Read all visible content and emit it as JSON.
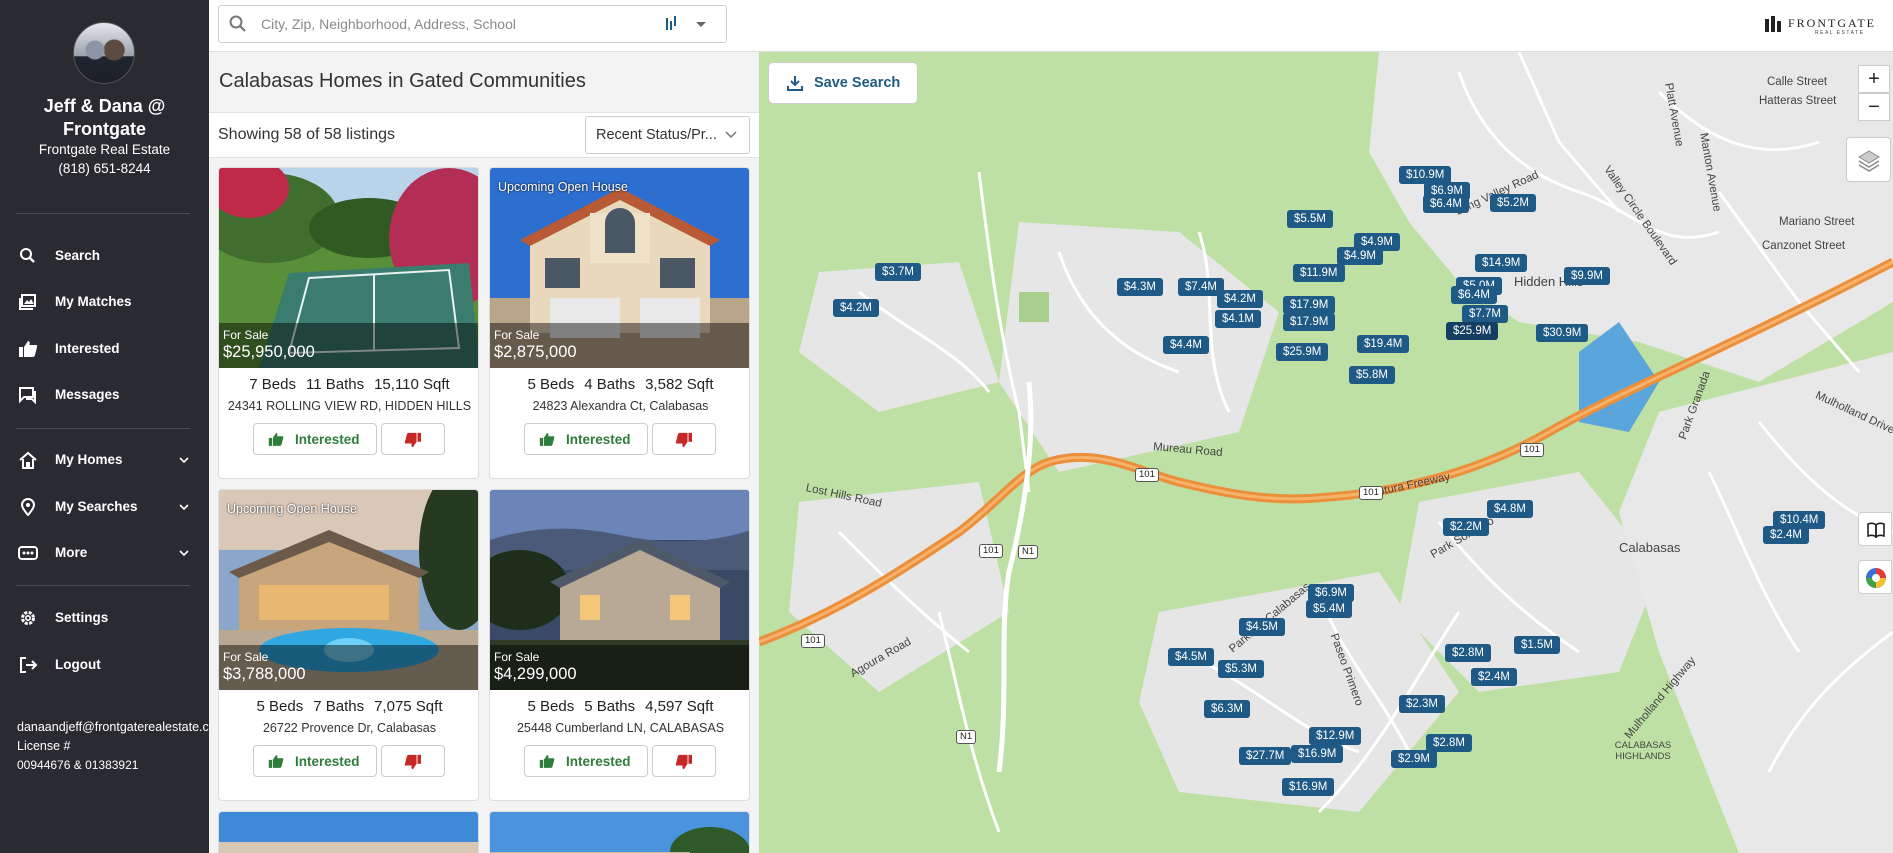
{
  "sidebar": {
    "agent_name": "Jeff & Dana @ Frontgate",
    "company": "Frontgate Real Estate",
    "phone": "(818) 651-8244",
    "nav": [
      {
        "label": "Search",
        "icon": "search-icon"
      },
      {
        "label": "My Matches",
        "icon": "gallery-icon"
      },
      {
        "label": "Interested",
        "icon": "thumbs-up-icon"
      },
      {
        "label": "Messages",
        "icon": "chat-icon"
      }
    ],
    "nav2": [
      {
        "label": "My Homes",
        "icon": "home-icon"
      },
      {
        "label": "My Searches",
        "icon": "location-pin-icon"
      },
      {
        "label": "More",
        "icon": "dots-icon"
      }
    ],
    "nav3": [
      {
        "label": "Settings",
        "icon": "gear-icon"
      },
      {
        "label": "Logout",
        "icon": "logout-icon"
      }
    ],
    "email": "danaandjeff@frontgaterealestate.com",
    "license_label": "License #",
    "license_numbers": "00944676 & 01383921"
  },
  "search": {
    "placeholder": "City, Zip, Neighborhood, Address, School"
  },
  "logo": {
    "name": "FRONTGATE",
    "sub": "REAL ESTATE"
  },
  "list": {
    "title": "Calabasas Homes in Gated Communities",
    "showing": "Showing 58 of 58 listings",
    "sort": "Recent Status/Pr...",
    "interested_label": "Interested",
    "listings": [
      {
        "status": "For Sale",
        "price": "$25,950,000",
        "beds": "7 Beds",
        "baths": "11 Baths",
        "sqft": "15,110 Sqft",
        "address": "24341 ROLLING VIEW RD, HIDDEN HILLS",
        "tag": ""
      },
      {
        "status": "For Sale",
        "price": "$2,875,000",
        "beds": "5 Beds",
        "baths": "4 Baths",
        "sqft": "3,582 Sqft",
        "address": "24823 Alexandra Ct, Calabasas",
        "tag": "Upcoming Open House"
      },
      {
        "status": "For Sale",
        "price": "$3,788,000",
        "beds": "5 Beds",
        "baths": "7 Baths",
        "sqft": "7,075 Sqft",
        "address": "26722 Provence Dr, Calabasas",
        "tag": "Upcoming Open House"
      },
      {
        "status": "For Sale",
        "price": "$4,299,000",
        "beds": "5 Beds",
        "baths": "5 Baths",
        "sqft": "4,597 Sqft",
        "address": "25448 Cumberland LN, CALABASAS",
        "tag": ""
      }
    ]
  },
  "map": {
    "save_search": "Save Search",
    "zoom_in": "+",
    "zoom_out": "−",
    "places": [
      "Calabasas",
      "CALABASAS HIGHLANDS",
      "Hidden Hills"
    ],
    "streets": [
      "Calle Street",
      "Hatteras Street",
      "Mariano Street",
      "Canzonet Street",
      "Platt Avenue",
      "Manton Avenue",
      "Valley Circle Boulevard",
      "Long Valley Road",
      "Mureau Road",
      "Ventura Freeway",
      "Lost Hills Road",
      "Agoura Road",
      "Park Granada",
      "Mulholland Drive",
      "Parkway Calabasas",
      "Paseo Primero",
      "Mulholland Highway",
      "Park Sorrento"
    ],
    "shields": [
      "101",
      "N1"
    ],
    "price_pins": [
      "$10.9M",
      "$6.9M",
      "$6.4M",
      "$5.2M",
      "$5.5M",
      "$4.9M",
      "$4.9M",
      "$14.9M",
      "$9.9M",
      "$3.7M",
      "$4.2M",
      "$4.3M",
      "$7.4M",
      "$4.2M",
      "$11.9M",
      "$5.0M",
      "$6.4M",
      "$7.7M",
      "$25.9M",
      "$30.9M",
      "$4.1M",
      "$17.9M",
      "$17.9M",
      "$4.4M",
      "$25.9M",
      "$19.4M",
      "$5.8M",
      "$4.8M",
      "$2.2M",
      "$10.4M",
      "$2.4M",
      "$6.9M",
      "$5.4M",
      "$4.5M",
      "$4.5M",
      "$5.3M",
      "$1.5M",
      "$2.8M",
      "$2.4M",
      "$2.3M",
      "$6.3M",
      "$12.9M",
      "$2.8M",
      "$27.7M",
      "$16.9M",
      "$2.9M",
      "$16.9M"
    ]
  }
}
